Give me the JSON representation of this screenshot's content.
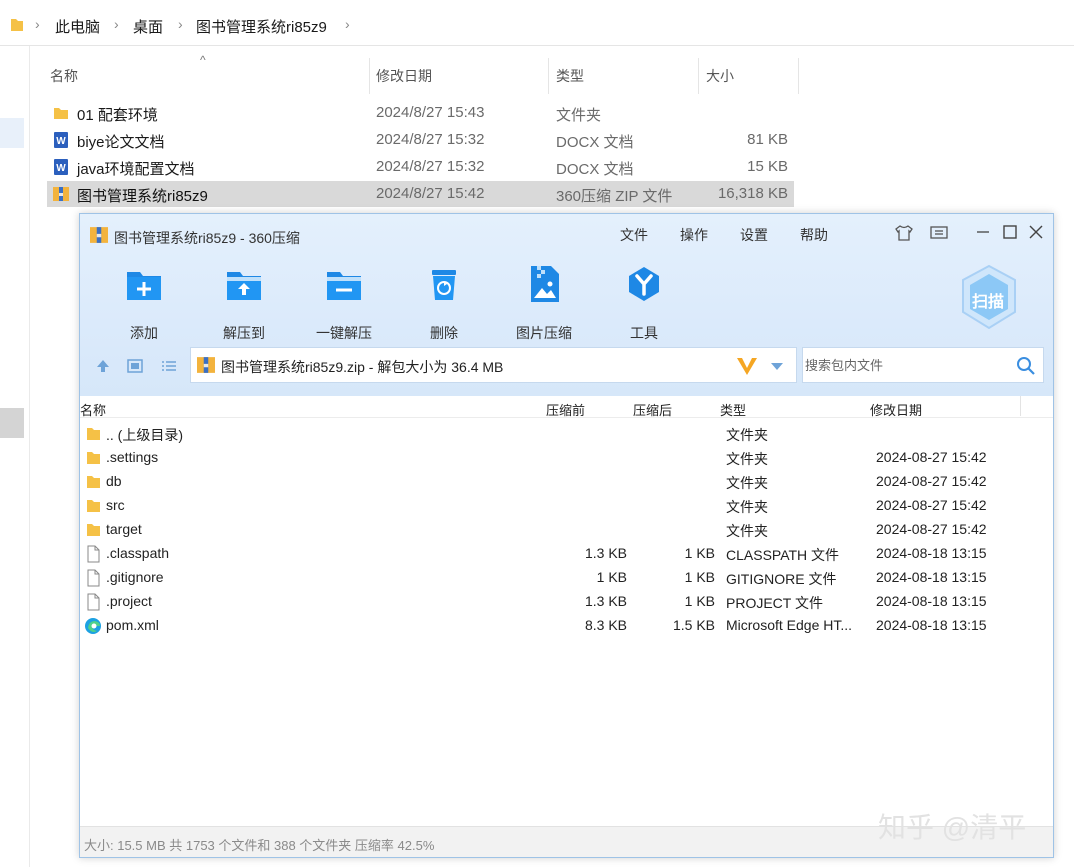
{
  "explorer": {
    "breadcrumb": [
      "此电脑",
      "桌面",
      "图书管理系统ri85z9"
    ],
    "sort_indicator": "^",
    "columns": {
      "name": "名称",
      "date": "修改日期",
      "type": "类型",
      "size": "大小"
    },
    "files": [
      {
        "name": "01 配套环境",
        "date": "2024/8/27 15:43",
        "type": "文件夹",
        "size": "",
        "icon": "folder-icon"
      },
      {
        "name": "biye论文文档",
        "date": "2024/8/27 15:32",
        "type": "DOCX 文档",
        "size": "81 KB",
        "icon": "word-doc-icon"
      },
      {
        "name": "java环境配置文档",
        "date": "2024/8/27 15:32",
        "type": "DOCX 文档",
        "size": "15 KB",
        "icon": "word-doc-icon"
      },
      {
        "name": "图书管理系统ri85z9",
        "date": "2024/8/27 15:42",
        "type": "360压缩 ZIP 文件",
        "size": "16,318 KB",
        "icon": "zip-archive-icon"
      }
    ]
  },
  "zip_window": {
    "title": "图书管理系统ri85z9 - 360压缩",
    "menu": [
      "文件",
      "操作",
      "设置",
      "帮助"
    ],
    "toolbar": [
      {
        "label": "添加",
        "icon": "add-icon"
      },
      {
        "label": "解压到",
        "icon": "extract-to-icon"
      },
      {
        "label": "一键解压",
        "icon": "one-click-extract-icon"
      },
      {
        "label": "删除",
        "icon": "delete-icon"
      },
      {
        "label": "图片压缩",
        "icon": "image-compress-icon"
      },
      {
        "label": "工具",
        "icon": "tools-icon"
      }
    ],
    "scan_label": "扫描",
    "path_text": "图书管理系统ri85z9.zip - 解包大小为 36.4 MB",
    "search_placeholder": "搜索包内文件",
    "columns": {
      "name": "名称",
      "compressed_before": "压缩前",
      "compressed_after": "压缩后",
      "type": "类型",
      "date": "修改日期"
    },
    "files": [
      {
        "name": ".. (上级目录)",
        "before": "",
        "after": "",
        "type": "文件夹",
        "date": "",
        "icon": "folder-icon"
      },
      {
        "name": ".settings",
        "before": "",
        "after": "",
        "type": "文件夹",
        "date": "2024-08-27 15:42",
        "icon": "folder-icon"
      },
      {
        "name": "db",
        "before": "",
        "after": "",
        "type": "文件夹",
        "date": "2024-08-27 15:42",
        "icon": "folder-icon"
      },
      {
        "name": "src",
        "before": "",
        "after": "",
        "type": "文件夹",
        "date": "2024-08-27 15:42",
        "icon": "folder-icon"
      },
      {
        "name": "target",
        "before": "",
        "after": "",
        "type": "文件夹",
        "date": "2024-08-27 15:42",
        "icon": "folder-icon"
      },
      {
        "name": ".classpath",
        "before": "1.3 KB",
        "after": "1 KB",
        "type": "CLASSPATH 文件",
        "date": "2024-08-18 13:15",
        "icon": "file-icon"
      },
      {
        "name": ".gitignore",
        "before": "1 KB",
        "after": "1 KB",
        "type": "GITIGNORE 文件",
        "date": "2024-08-18 13:15",
        "icon": "file-icon"
      },
      {
        "name": ".project",
        "before": "1.3 KB",
        "after": "1 KB",
        "type": "PROJECT 文件",
        "date": "2024-08-18 13:15",
        "icon": "file-icon"
      },
      {
        "name": "pom.xml",
        "before": "8.3 KB",
        "after": "1.5 KB",
        "type": "Microsoft Edge HT...",
        "date": "2024-08-18 13:15",
        "icon": "edge-icon"
      }
    ],
    "status": "大小: 15.5 MB 共 1753 个文件和 388 个文件夹 压缩率 42.5%"
  },
  "watermark": "知乎 @清平",
  "colors": {
    "accent": "#1e88e5",
    "toolbar_bg": "#dbeafb",
    "selection": "#d9d9d9",
    "folder": "#f5c146"
  }
}
